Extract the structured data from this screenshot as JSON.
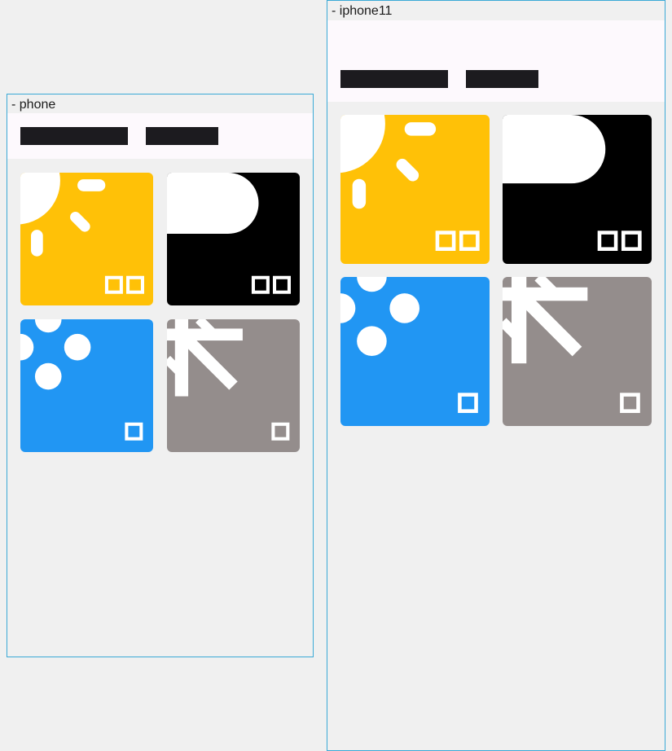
{
  "colors": {
    "sunny": "#ffc107",
    "night": "#000000",
    "rain": "#2196f3",
    "snow": "#948d8c",
    "frame_border": "#3aa9d6",
    "appbar_bg": "#fdf9fd",
    "redacted_bar": "#1c1b1f"
  },
  "frames": [
    {
      "label": "- phone"
    },
    {
      "label": "- iphone11"
    }
  ],
  "tiles": [
    {
      "icon": "sun-icon",
      "badge": "double-square"
    },
    {
      "icon": "moon-icon",
      "badge": "double-square"
    },
    {
      "icon": "rain-drops-icon",
      "badge": "single-square"
    },
    {
      "icon": "snowflake-icon",
      "badge": "single-square"
    }
  ]
}
